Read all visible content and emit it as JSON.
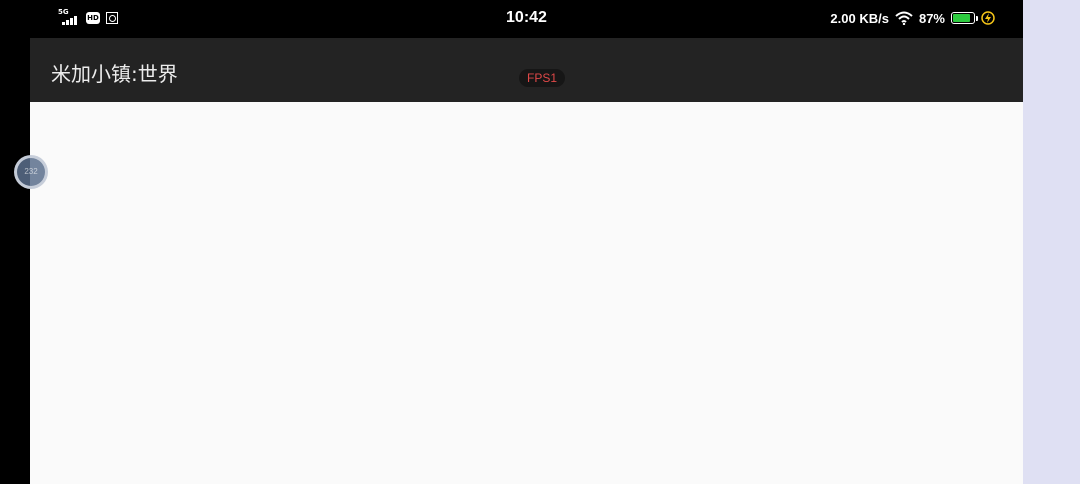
{
  "status_bar": {
    "network_type": "5G",
    "hd_label": "HD",
    "time": "10:42",
    "net_speed": "2.00 KB/s",
    "battery_percent": "87%",
    "battery_level": 0.87,
    "battery_color": "#2ecc40",
    "charging_color": "#f5c518"
  },
  "app_bar": {
    "title": "米加小镇:世界",
    "fps_label": "FPS1",
    "fps_color": "#e04848"
  },
  "float_ball": {
    "label": "232"
  }
}
